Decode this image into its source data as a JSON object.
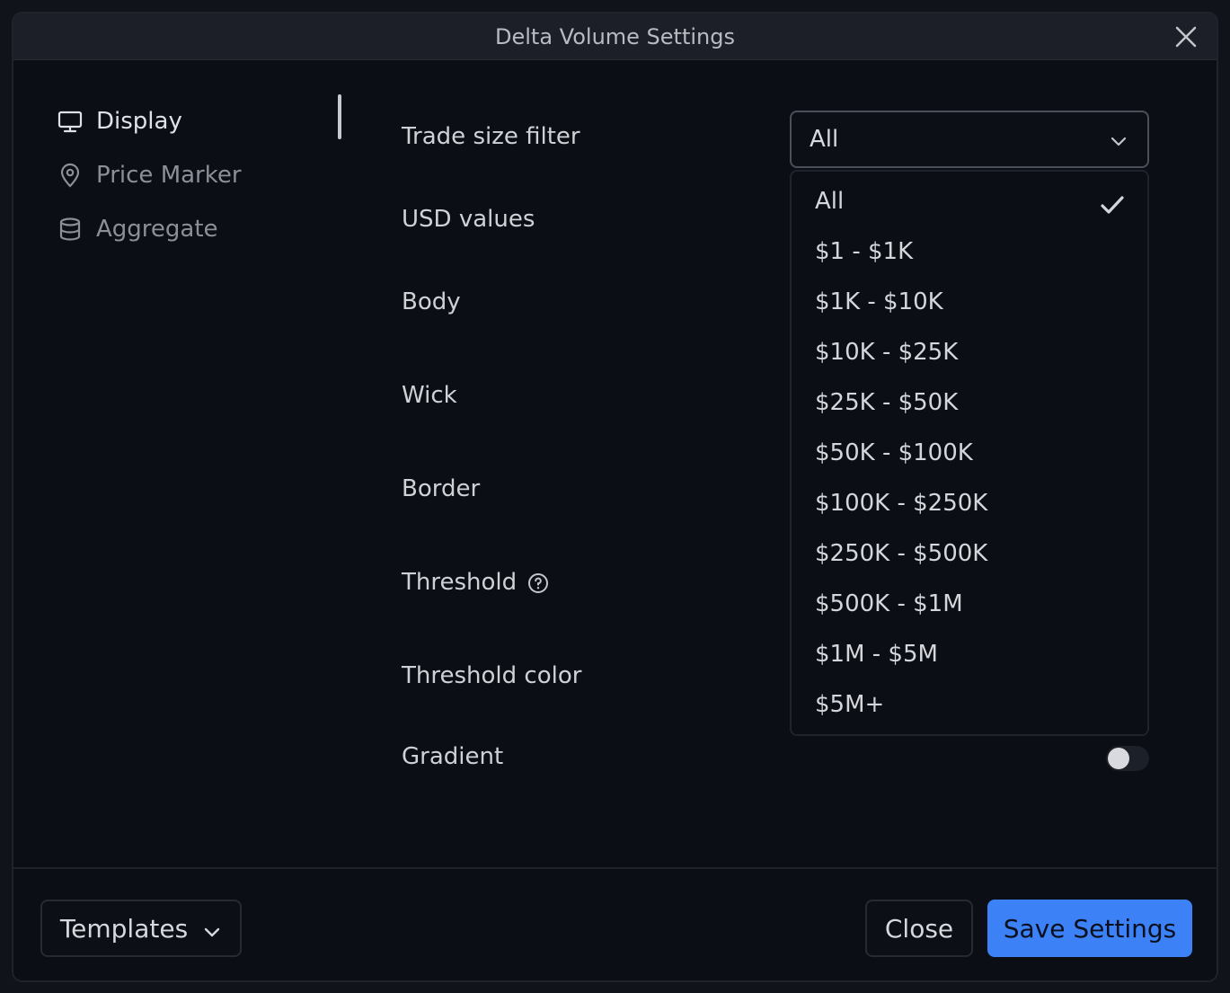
{
  "dialog": {
    "title": "Delta Volume Settings"
  },
  "sidebar": {
    "items": [
      {
        "label": "Display",
        "icon": "monitor-icon",
        "active": true
      },
      {
        "label": "Price Marker",
        "icon": "map-pin-icon",
        "active": false
      },
      {
        "label": "Aggregate",
        "icon": "database-icon",
        "active": false
      }
    ]
  },
  "settings": {
    "trade_size_filter": "Trade size filter",
    "usd_values": "USD values",
    "body": "Body",
    "wick": "Wick",
    "border": "Border",
    "threshold": "Threshold",
    "threshold_color": "Threshold color",
    "gradient": "Gradient",
    "gradient_enabled": false
  },
  "select": {
    "value": "All",
    "options": [
      "All",
      "$1 - $1K",
      "$1K - $10K",
      "$10K - $25K",
      "$25K - $50K",
      "$50K - $100K",
      "$100K - $250K",
      "$250K - $500K",
      "$500K - $1M",
      "$1M - $5M",
      "$5M+"
    ],
    "selected_index": 0
  },
  "footer": {
    "templates_label": "Templates",
    "close_label": "Close",
    "save_label": "Save Settings"
  },
  "colors": {
    "accent": "#3c82f6",
    "background": "#0b0e14",
    "titlebar": "#1c1f27"
  }
}
